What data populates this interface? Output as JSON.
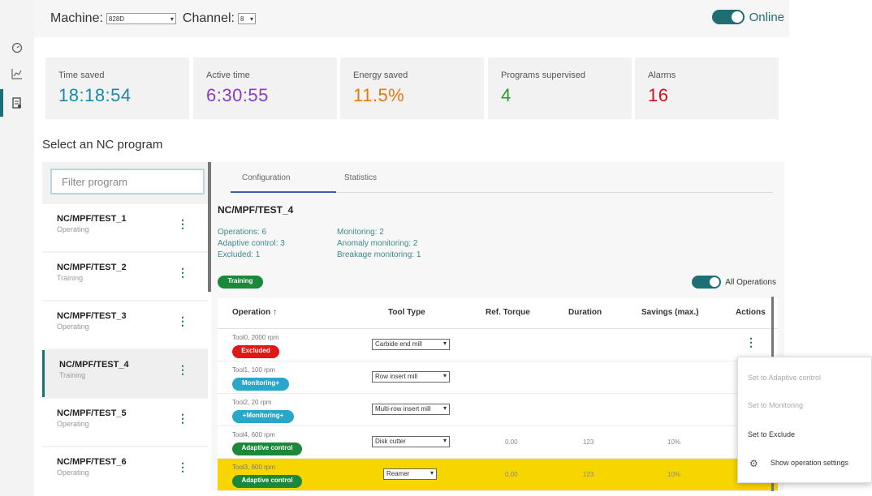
{
  "header": {
    "machine_label": "Machine:",
    "machine_value": "828D",
    "channel_label": "Channel:",
    "channel_value": "8",
    "online_label": "Online"
  },
  "rail": {
    "items": [
      "dashboard-icon",
      "chart-icon",
      "document-icon"
    ]
  },
  "kpis": [
    {
      "label": "Time saved",
      "value": "18:18:54",
      "color": "#1a8aa6"
    },
    {
      "label": "Active time",
      "value": "6:30:55",
      "color": "#8a3cc6"
    },
    {
      "label": "Energy saved",
      "value": "11.5%",
      "color": "#e07a10"
    },
    {
      "label": "Programs supervised",
      "value": "4",
      "color": "#2a9a2a"
    },
    {
      "label": "Alarms",
      "value": "16",
      "color": "#d01020"
    }
  ],
  "section_title": "Select an NC program",
  "filter_placeholder": "Filter program",
  "programs": [
    {
      "name": "NC/MPF/TEST_1",
      "state": "Operating"
    },
    {
      "name": "NC/MPF/TEST_2",
      "state": "Training"
    },
    {
      "name": "NC/MPF/TEST_3",
      "state": "Operating"
    },
    {
      "name": "NC/MPF/TEST_4",
      "state": "Training"
    },
    {
      "name": "NC/MPF/TEST_5",
      "state": "Operating"
    },
    {
      "name": "NC/MPF/TEST_6",
      "state": "Operating"
    }
  ],
  "tabs": {
    "configuration": "Configuration",
    "statistics": "Statistics"
  },
  "detail": {
    "title": "NC/MPF/TEST_4",
    "operations": "Operations: 6",
    "adaptive_control": "Adaptive control: 3",
    "excluded": "Excluded: 1",
    "monitoring": "Monitoring: 2",
    "anomaly_monitoring": "Anomaly monitoring: 2",
    "breakage_monitoring": "Breakage monitoring: 1",
    "mode_badge": "Training",
    "all_operations_label": "All Operations"
  },
  "table": {
    "headers": {
      "operation": "Operation ↑",
      "tool_type": "Tool Type",
      "ref_torque": "Ref. Torque",
      "duration": "Duration",
      "savings": "Savings (max.)",
      "actions": "Actions"
    },
    "rows": [
      {
        "op": "Tool0, 2000 rpm",
        "badge": "Excluded",
        "badge_color": "#e01818",
        "tool": "Carbide end mill",
        "torque": "",
        "duration": "",
        "savings": ""
      },
      {
        "op": "Tool1, 100 rpm",
        "badge": "Monitoring+",
        "badge_color": "#2aa6c8",
        "tool": "Row insert mill",
        "torque": "",
        "duration": "",
        "savings": ""
      },
      {
        "op": "Tool2, 20 rpm",
        "badge": "+Monitoring+",
        "badge_color": "#2aa6c8",
        "tool": "Multi-row insert mill",
        "torque": "",
        "duration": "",
        "savings": ""
      },
      {
        "op": "Tool4, 600 rpm",
        "badge": "Adaptive control",
        "badge_color": "#1a8a3a",
        "tool": "Disk cutter",
        "torque": "0.00",
        "duration": "123",
        "savings": "10%"
      },
      {
        "op": "Tool3, 600 rpm",
        "badge": "Adaptive control",
        "badge_color": "#1a8a3a",
        "tool": "Reamer",
        "torque": "0.00",
        "duration": "123",
        "savings": "10%"
      }
    ]
  },
  "menu": {
    "adaptive": "Set to Adaptive control",
    "monitoring": "Set to Monitoring",
    "exclude": "Set to Exclude",
    "settings": "Show operation settings"
  },
  "colors": {
    "accent": "#1d6f73",
    "highlight": "#f7d600"
  }
}
